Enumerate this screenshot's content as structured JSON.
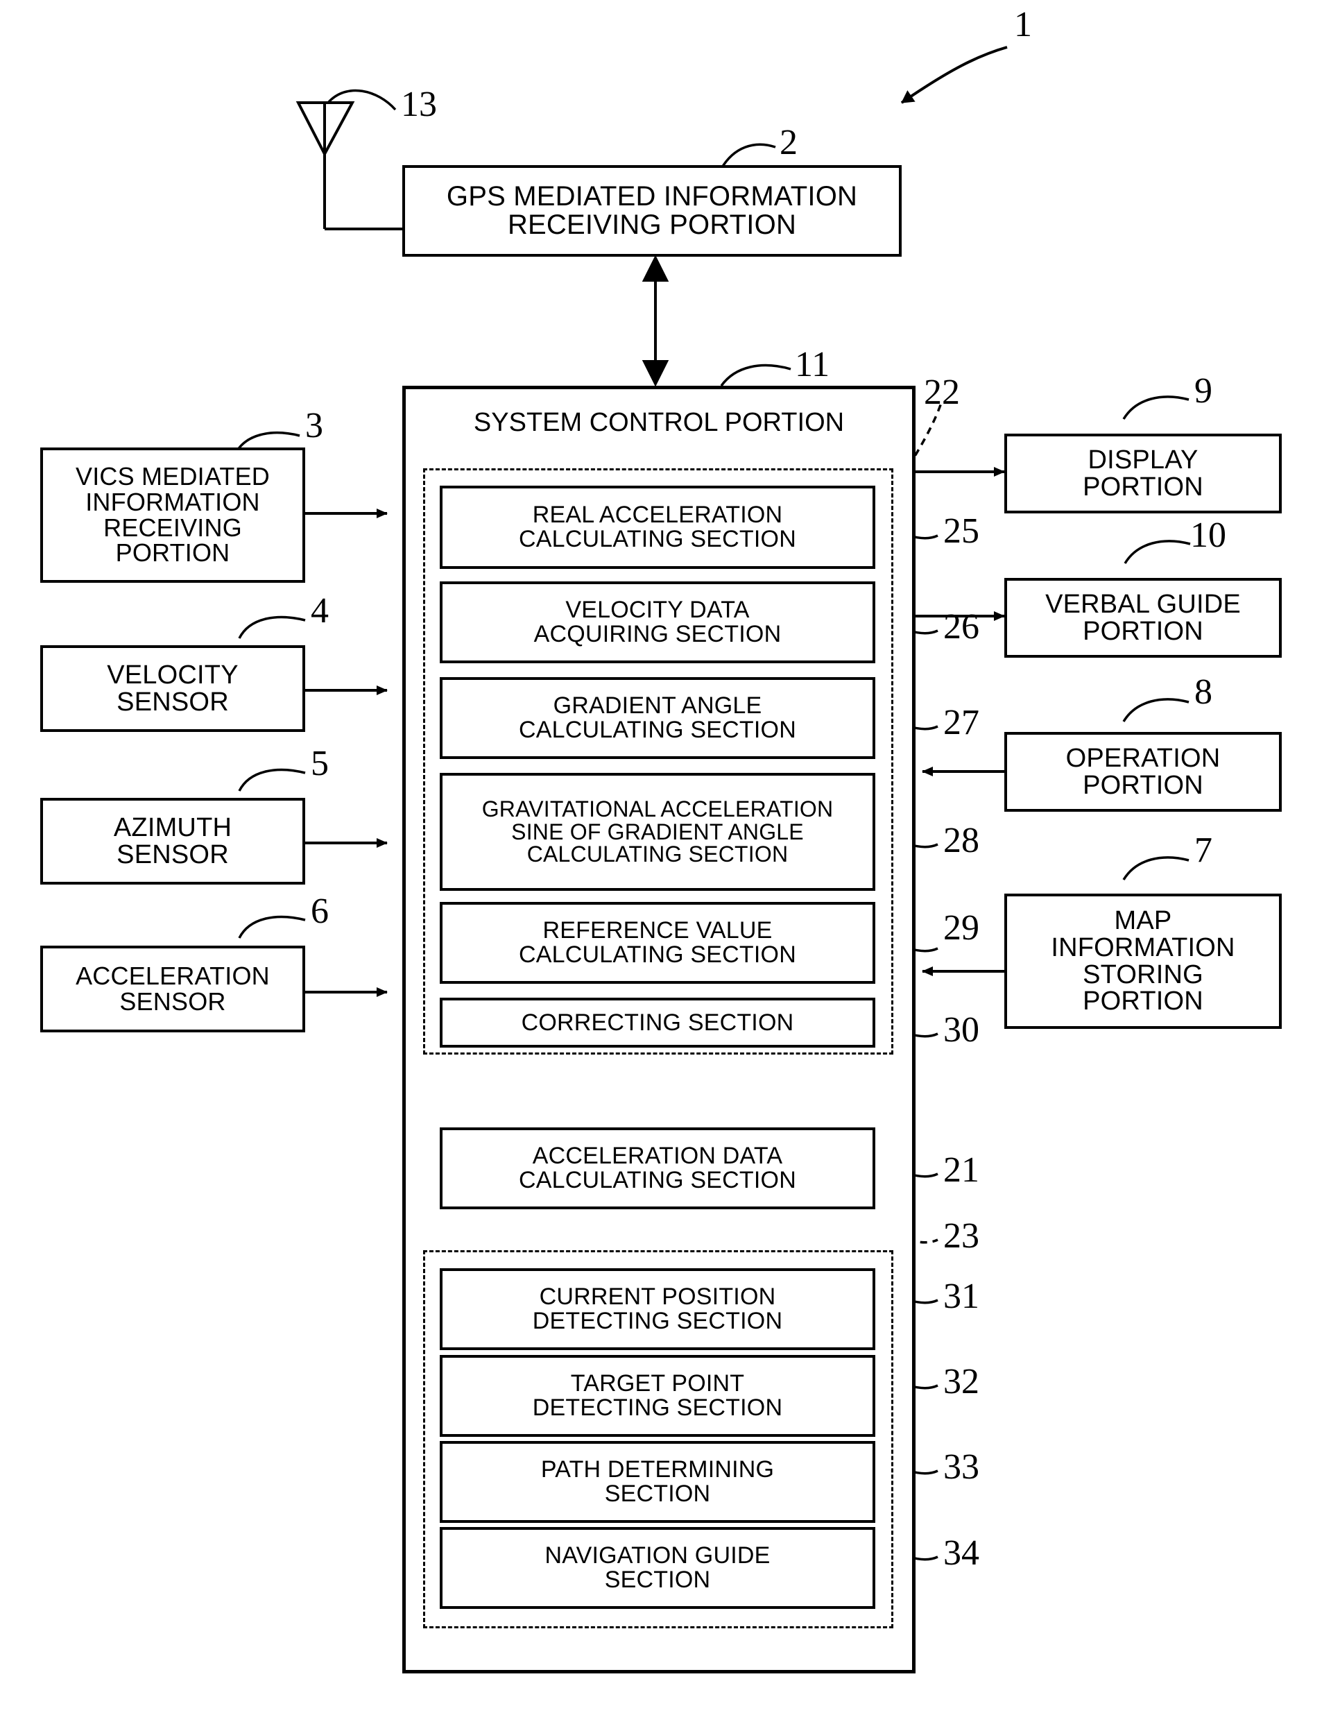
{
  "figure": {
    "type": "patent-block-diagram",
    "title": "Vehicle navigation system block diagram"
  },
  "blocks": {
    "gps": {
      "label": "GPS MEDIATED INFORMATION\nRECEIVING PORTION",
      "ref": "2"
    },
    "vics": {
      "label": "VICS MEDIATED\nINFORMATION\nRECEIVING\nPORTION",
      "ref": "3"
    },
    "velocity_sensor": {
      "label": "VELOCITY\nSENSOR",
      "ref": "4"
    },
    "azimuth_sensor": {
      "label": "AZIMUTH\nSENSOR",
      "ref": "5"
    },
    "acceleration_sensor": {
      "label": "ACCELERATION\nSENSOR",
      "ref": "6"
    },
    "display": {
      "label": "DISPLAY\nPORTION",
      "ref": "9"
    },
    "verbal_guide": {
      "label": "VERBAL GUIDE\nPORTION",
      "ref": "10"
    },
    "operation": {
      "label": "OPERATION\nPORTION",
      "ref": "8"
    },
    "map_info": {
      "label": "MAP\nINFORMATION\nSTORING\nPORTION",
      "ref": "7"
    },
    "system_control": {
      "label": "SYSTEM CONTROL PORTION",
      "ref": "11"
    },
    "real_accel": {
      "label": "REAL ACCELERATION\nCALCULATING SECTION",
      "ref": "25"
    },
    "velocity_data": {
      "label": "VELOCITY DATA\nACQUIRING SECTION",
      "ref": "26"
    },
    "gradient_angle": {
      "label": "GRADIENT ANGLE\nCALCULATING SECTION",
      "ref": "27"
    },
    "grav_accel_sine": {
      "label": "GRAVITATIONAL ACCELERATION\nSINE OF GRADIENT ANGLE\nCALCULATING SECTION",
      "ref": "28"
    },
    "reference_value": {
      "label": "REFERENCE VALUE\nCALCULATING SECTION",
      "ref": "29"
    },
    "correcting": {
      "label": "CORRECTING SECTION",
      "ref": "30"
    },
    "accel_data": {
      "label": "ACCELERATION DATA\nCALCULATING SECTION",
      "ref": "21"
    },
    "current_position": {
      "label": "CURRENT POSITION\nDETECTING SECTION",
      "ref": "31"
    },
    "target_point": {
      "label": "TARGET POINT\nDETECTING SECTION",
      "ref": "32"
    },
    "path_determining": {
      "label": "PATH DETERMINING\nSECTION",
      "ref": "33"
    },
    "navigation_guide": {
      "label": "NAVIGATION GUIDE\nSECTION",
      "ref": "34"
    }
  },
  "groups": {
    "correction_group": {
      "ref": "22"
    },
    "navigation_group": {
      "ref": "23"
    }
  },
  "symbols": {
    "antenna": {
      "ref": "13",
      "name": "antenna-symbol"
    },
    "system": {
      "ref": "1",
      "name": "whole-system-callout"
    }
  }
}
